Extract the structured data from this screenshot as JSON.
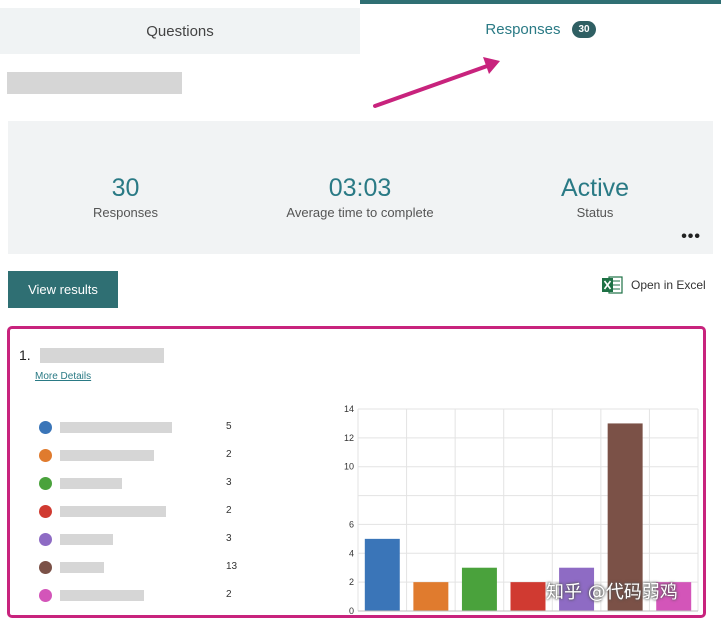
{
  "tabs": {
    "questions_label": "Questions",
    "responses_label": "Responses",
    "responses_badge": "30"
  },
  "summary": {
    "responses_value": "30",
    "responses_label": "Responses",
    "avg_time_value": "03:03",
    "avg_time_label": "Average time to complete",
    "status_value": "Active",
    "status_label": "Status",
    "more_label": "•••"
  },
  "actions": {
    "view_results_label": "View results",
    "open_excel_label": "Open in Excel"
  },
  "question": {
    "number": "1.",
    "more_details_label": "More Details",
    "options": [
      {
        "count": "5",
        "color": "#3a75b8"
      },
      {
        "count": "2",
        "color": "#e07b2e"
      },
      {
        "count": "3",
        "color": "#4aa23c"
      },
      {
        "count": "2",
        "color": "#d03a31"
      },
      {
        "count": "3",
        "color": "#8e6bc4"
      },
      {
        "count": "13",
        "color": "#7b5147"
      },
      {
        "count": "2",
        "color": "#d355b9"
      }
    ]
  },
  "chart_data": {
    "type": "bar",
    "categories": [
      "",
      "",
      "",
      "",
      "",
      "",
      ""
    ],
    "values": [
      5,
      2,
      3,
      2,
      3,
      13,
      2
    ],
    "colors": [
      "#3a75b8",
      "#e07b2e",
      "#4aa23c",
      "#d03a31",
      "#8e6bc4",
      "#7b5147",
      "#d355b9"
    ],
    "yticks": [
      "0",
      "2",
      "4",
      "6",
      "10",
      "12",
      "14"
    ],
    "ylim": [
      0,
      14
    ],
    "grid": true
  },
  "watermark": "知乎 @代码弱鸡",
  "colors": {
    "accent": "#2f6f73",
    "highlight": "#c8237d"
  }
}
